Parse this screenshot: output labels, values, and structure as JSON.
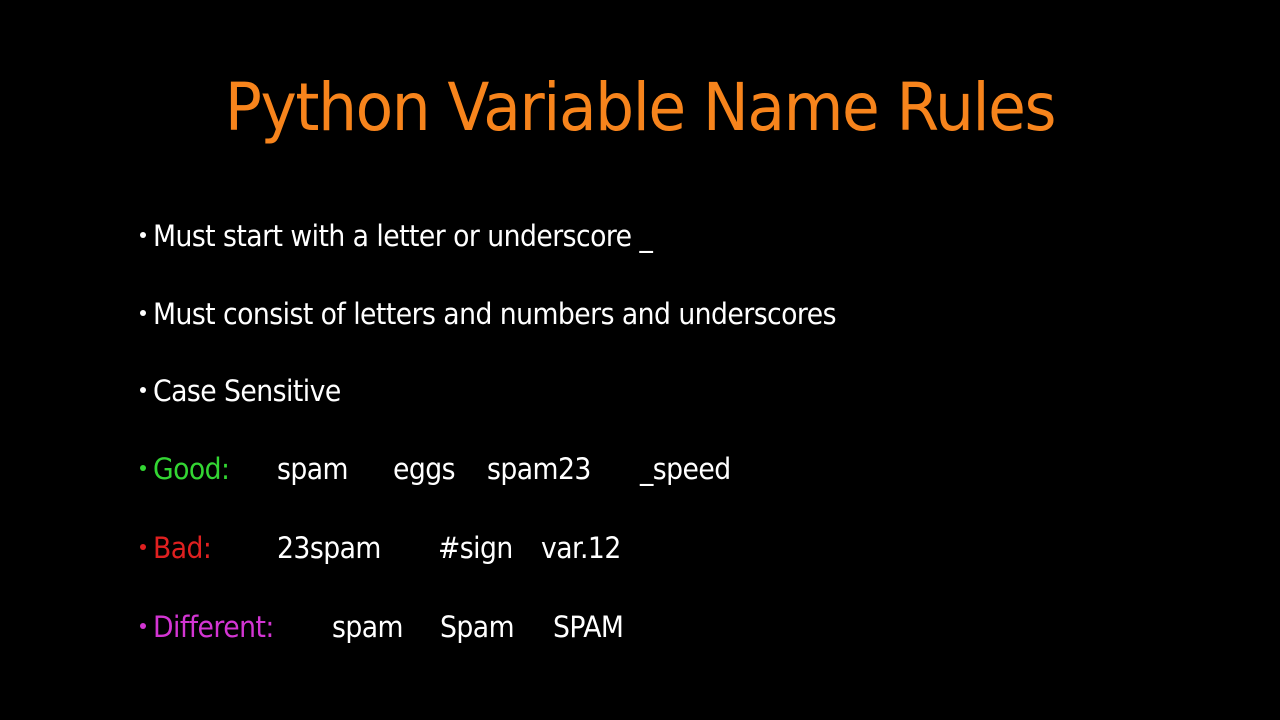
{
  "slide": {
    "title": "Python Variable Name Rules",
    "colors": {
      "title": "#f7841c",
      "text": "#ffffff",
      "background": "#000000",
      "good": "#33d633",
      "bad": "#e02020",
      "different": "#d335d3"
    },
    "rules": [
      {
        "text": "Must start with a letter or underscore _"
      },
      {
        "text": "Must consist of letters and numbers and underscores"
      },
      {
        "text": "Case Sensitive"
      }
    ],
    "examples": {
      "good": {
        "label": "Good:",
        "items": [
          "spam",
          "eggs",
          "spam23",
          "_speed"
        ]
      },
      "bad": {
        "label": "Bad:",
        "items": [
          "23spam",
          "#sign",
          "var.12"
        ]
      },
      "different": {
        "label": "Different:",
        "items": [
          "spam",
          "Spam",
          "SPAM"
        ]
      }
    }
  }
}
